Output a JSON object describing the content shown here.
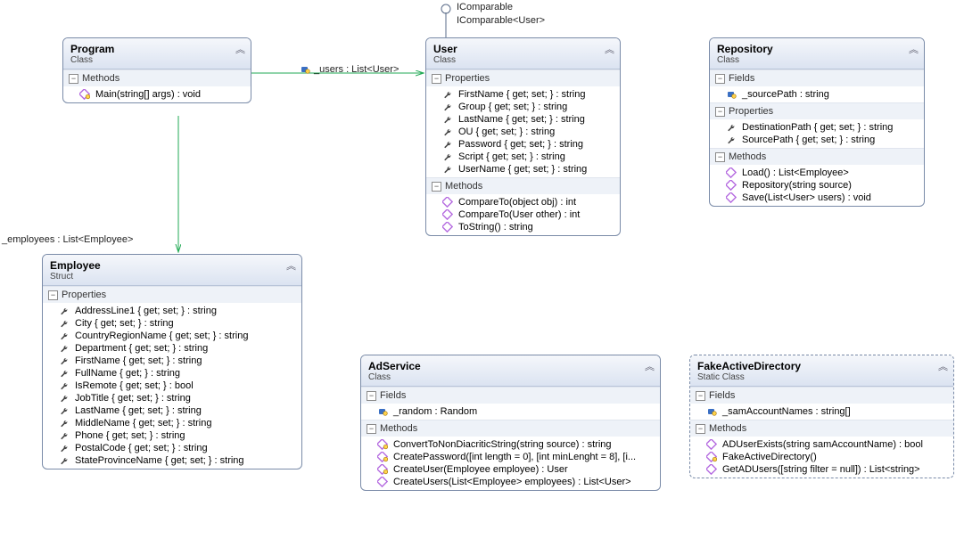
{
  "interfaces": [
    "IComparable",
    "IComparable<User>"
  ],
  "assoc": {
    "users": "_users : List<User>",
    "employees": "_employees : List<Employee>"
  },
  "sections": {
    "methods": "Methods",
    "properties": "Properties",
    "fields": "Fields"
  },
  "cls": {
    "program": {
      "title": "Program",
      "kind": "Class",
      "methods": [
        {
          "name": "Main(string[] args) : void",
          "icon": "method-priv"
        }
      ]
    },
    "user": {
      "title": "User",
      "kind": "Class",
      "properties": [
        {
          "name": "FirstName { get; set; } : string"
        },
        {
          "name": "Group { get; set; } : string"
        },
        {
          "name": "LastName { get; set; } : string"
        },
        {
          "name": "OU { get; set; } : string"
        },
        {
          "name": "Password { get; set; } : string"
        },
        {
          "name": "Script { get; set; } : string"
        },
        {
          "name": "UserName { get; set; } : string"
        }
      ],
      "methods": [
        {
          "name": "CompareTo(object obj) : int",
          "icon": "method"
        },
        {
          "name": "CompareTo(User other) : int",
          "icon": "method"
        },
        {
          "name": "ToString() : string",
          "icon": "method"
        }
      ]
    },
    "repository": {
      "title": "Repository",
      "kind": "Class",
      "fields": [
        {
          "name": "_sourcePath : string",
          "icon": "field-priv"
        }
      ],
      "properties": [
        {
          "name": "DestinationPath { get; set; } : string"
        },
        {
          "name": "SourcePath { get; set; } : string"
        }
      ],
      "methods": [
        {
          "name": "Load() : List<Employee>",
          "icon": "method"
        },
        {
          "name": "Repository(string source)",
          "icon": "method"
        },
        {
          "name": "Save(List<User> users) : void",
          "icon": "method"
        }
      ]
    },
    "employee": {
      "title": "Employee",
      "kind": "Struct",
      "properties": [
        {
          "name": "AddressLine1 { get; set; } : string"
        },
        {
          "name": "City { get; set; } : string"
        },
        {
          "name": "CountryRegionName { get; set; } : string"
        },
        {
          "name": "Department { get; set; } : string"
        },
        {
          "name": "FirstName { get; set; } : string"
        },
        {
          "name": "FullName { get; } : string"
        },
        {
          "name": "IsRemote { get; set; } : bool"
        },
        {
          "name": "JobTitle { get; set; } : string"
        },
        {
          "name": "LastName { get; set; } : string"
        },
        {
          "name": "MiddleName { get; set; } : string"
        },
        {
          "name": "Phone { get; set; } : string"
        },
        {
          "name": "PostalCode { get; set; } : string"
        },
        {
          "name": "StateProvinceName { get; set; } : string"
        }
      ]
    },
    "adservice": {
      "title": "AdService",
      "kind": "Class",
      "fields": [
        {
          "name": "_random : Random",
          "icon": "field-priv"
        }
      ],
      "methods": [
        {
          "name": "ConvertToNonDiacriticString(string source) : string",
          "icon": "method-priv"
        },
        {
          "name": "CreatePassword([int length = 0], [int minLenght = 8], [i...",
          "icon": "method-priv"
        },
        {
          "name": "CreateUser(Employee employee) : User",
          "icon": "method-priv"
        },
        {
          "name": "CreateUsers(List<Employee> employees) : List<User>",
          "icon": "method"
        }
      ]
    },
    "fakead": {
      "title": "FakeActiveDirectory",
      "kind": "Static Class",
      "fields": [
        {
          "name": "_samAccountNames : string[]",
          "icon": "field-priv"
        }
      ],
      "methods": [
        {
          "name": "ADUserExists(string samAccountName) : bool",
          "icon": "method"
        },
        {
          "name": "FakeActiveDirectory()",
          "icon": "method-priv"
        },
        {
          "name": "GetADUsers([string filter = null]) : List<string>",
          "icon": "method"
        }
      ]
    }
  }
}
